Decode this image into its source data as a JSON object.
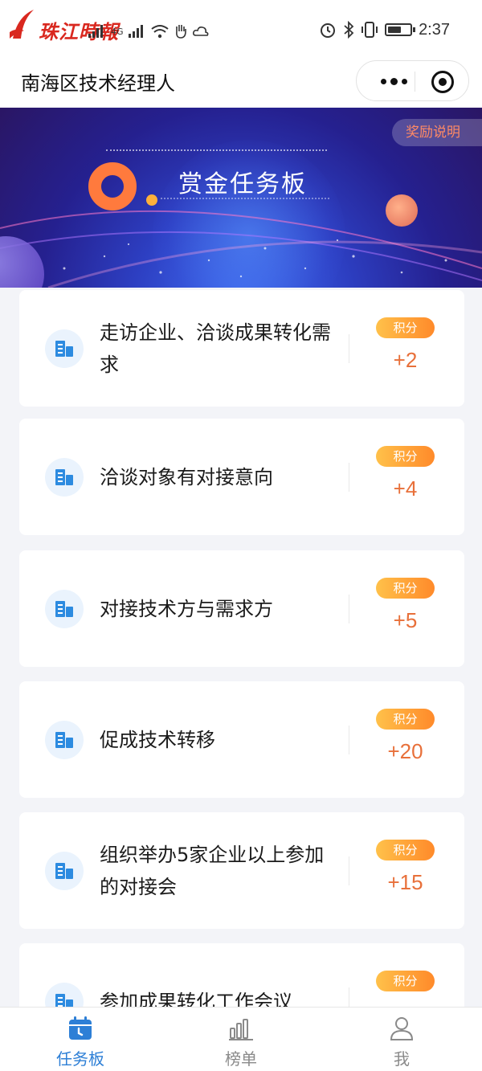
{
  "status_bar": {
    "logo_text": "珠江時報",
    "network": "4G",
    "time": "2:37",
    "battery_level": 0.6
  },
  "title_bar": {
    "title": "南海区技术经理人"
  },
  "banner": {
    "title": "赏金任务板",
    "reward_button": "奖励说明"
  },
  "tasks": [
    {
      "title": "走访企业、洽谈成果转化需求",
      "badge": "积分",
      "points": "+2"
    },
    {
      "title": "洽谈对象有对接意向",
      "badge": "积分",
      "points": "+4"
    },
    {
      "title": "对接技术方与需求方",
      "badge": "积分",
      "points": "+5"
    },
    {
      "title": "促成技术转移",
      "badge": "积分",
      "points": "+20"
    },
    {
      "title": "组织举办5家企业以上参加的对接会",
      "badge": "积分",
      "points": "+15"
    },
    {
      "title": "参加成果转化工作会议",
      "badge": "积分",
      "points": ""
    }
  ],
  "tab_bar": {
    "tabs": [
      {
        "label": "任务板",
        "icon": "calendar-icon",
        "active": true
      },
      {
        "label": "榜单",
        "icon": "bar-chart-icon",
        "active": false
      },
      {
        "label": "我",
        "icon": "user-icon",
        "active": false
      }
    ]
  },
  "colors": {
    "accent_blue": "#2d7fd6",
    "points_orange": "#e8703a",
    "banner_blue": "#2d3fc2"
  }
}
